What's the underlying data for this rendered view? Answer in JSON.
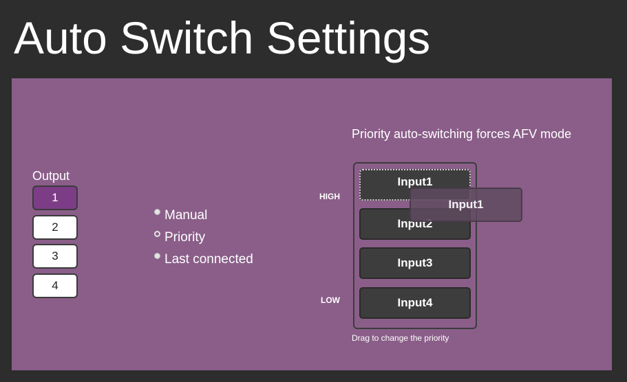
{
  "title": "Auto Switch Settings",
  "output": {
    "label": "Output",
    "buttons": [
      "1",
      "2",
      "3",
      "4"
    ],
    "selected": "1"
  },
  "mode": {
    "options": [
      "Manual",
      "Priority",
      "Last connected"
    ],
    "selected": "Priority"
  },
  "priority": {
    "note": "Priority auto-switching forces AFV mode",
    "high_label": "HIGH",
    "low_label": "LOW",
    "inputs": [
      "Input1",
      "Input2",
      "Input3",
      "Input4"
    ],
    "dragging": "Input1",
    "hint": "Drag to change the priority"
  },
  "colors": {
    "background": "#2d2d2d",
    "panel": "#8a5e89",
    "selected_output": "#7d3d86",
    "input_button": "#3d3d3d"
  }
}
